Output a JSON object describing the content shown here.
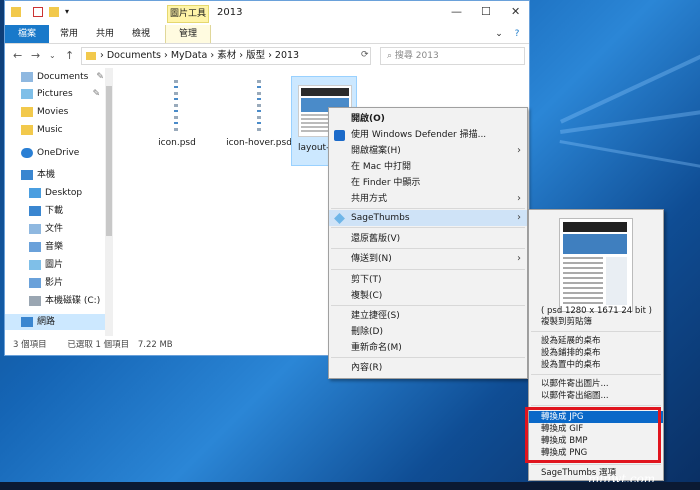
{
  "window": {
    "title": "2013",
    "tool_tab": "圖片工具",
    "ribbon_tabs": [
      "檔案",
      "常用",
      "共用",
      "檢視",
      "管理"
    ],
    "address_path": [
      "Documents",
      "MyData",
      "素材",
      "版型",
      "2013"
    ],
    "search_placeholder": "搜尋 2013",
    "nav": {
      "back": "←",
      "forward": "→",
      "up": "↑",
      "refresh": "⟳",
      "dropdown": "⌄",
      "help": "?"
    },
    "controls": {
      "min": "—",
      "max": "☐",
      "close": "✕"
    }
  },
  "sidebar": {
    "items": [
      {
        "label": "Documents",
        "pinned": true
      },
      {
        "label": "Pictures",
        "pinned": true
      },
      {
        "label": "Movies",
        "pinned": false
      },
      {
        "label": "Music",
        "pinned": false
      },
      {
        "label": "OneDrive",
        "pinned": false
      },
      {
        "label": "本機",
        "pinned": false
      },
      {
        "label": "Desktop",
        "pinned": false
      },
      {
        "label": "下載",
        "pinned": false
      },
      {
        "label": "文件",
        "pinned": false
      },
      {
        "label": "音樂",
        "pinned": false
      },
      {
        "label": "圖片",
        "pinned": false
      },
      {
        "label": "影片",
        "pinned": false
      },
      {
        "label": "本機磁碟 (C:)",
        "pinned": false
      },
      {
        "label": "網路",
        "pinned": false
      }
    ]
  },
  "files": [
    {
      "name": "icon.psd"
    },
    {
      "name": "icon-hover.psd"
    },
    {
      "name": "layout-"
    }
  ],
  "status": {
    "count": "3 個項目",
    "selected": "已選取 1 個項目",
    "size": "7.22 MB"
  },
  "context_menu": {
    "items": [
      {
        "label": "開啟(O)",
        "bold": true
      },
      {
        "label": "使用 Windows Defender 掃描..."
      },
      {
        "label": "開啟檔案(H)",
        "submenu": true
      },
      {
        "label": "在 Mac 中打開"
      },
      {
        "label": "在 Finder 中顯示"
      },
      {
        "label": "共用方式",
        "submenu": true
      },
      {
        "label": "SageThumbs",
        "submenu": true,
        "highlighted": true
      },
      {
        "label": "還原舊版(V)"
      },
      {
        "label": "傳送到(N)",
        "submenu": true
      },
      {
        "label": "剪下(T)"
      },
      {
        "label": "複製(C)"
      },
      {
        "label": "建立捷徑(S)"
      },
      {
        "label": "刪除(D)"
      },
      {
        "label": "重新命名(M)"
      },
      {
        "label": "內容(R)"
      }
    ]
  },
  "submenu": {
    "info": "( psd 1280 x 1671 24 bit )",
    "items": [
      "複製到剪貼簿",
      "設為延展的桌布",
      "設為鋪排的桌布",
      "設為置中的桌布",
      "以郵件寄出圖片...",
      "以郵件寄出縮圖...",
      "轉換成 JPG",
      "轉換成 GIF",
      "轉換成 BMP",
      "轉換成 PNG",
      "SageThumbs 選項"
    ],
    "highlighted_index": 6
  },
  "watermark": "minwt.com",
  "colors": {
    "accent": "#1979ca",
    "highlight": "#0a68c8",
    "redbox": "#e0141e"
  }
}
